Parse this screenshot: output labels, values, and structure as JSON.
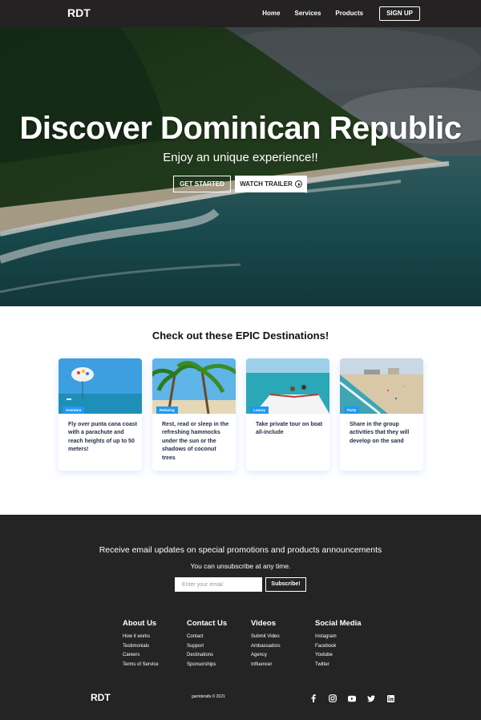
{
  "navbar": {
    "logo": "RDT",
    "links": [
      "Home",
      "Services",
      "Products"
    ],
    "signup": "SIGN UP"
  },
  "hero": {
    "title": "Discover Dominican Republic",
    "subtitle": "Enjoy an unique experience!!",
    "get_started": "GET STARTED",
    "watch_trailer": "WATCH TRAILER",
    "play_icon": "play-circle-icon"
  },
  "destinations": {
    "heading": "Check out these EPIC Destinations!",
    "cards": [
      {
        "badge": "Aventura",
        "text": "Fly over punta cana coast with a parachute and reach heights of up to 50 meters!"
      },
      {
        "badge": "Relaxing",
        "text": "Rest, read or sleep in the refreshing hammocks under the sun or the shadows of coconut trees"
      },
      {
        "badge": "Luxury",
        "text": "Take private tour on boat all-include"
      },
      {
        "badge": "Party",
        "text": "Share in the group activities that they will develop on the sand"
      }
    ]
  },
  "footer": {
    "subscription_heading": "Receive email updates on special promotions and products announcements",
    "subscription_text": "You can unsubscribe at any time.",
    "email_placeholder": "Enter your email",
    "subscribe_label": "Subscribe!",
    "columns": [
      {
        "title": "About Us",
        "links": [
          "How it works",
          "Testimonials",
          "Careers",
          "Terms of Service"
        ]
      },
      {
        "title": "Contact Us",
        "links": [
          "Contact",
          "Support",
          "Destinations",
          "Sponsorships"
        ]
      },
      {
        "title": "Videos",
        "links": [
          "Submit Video",
          "Ambassadors",
          "Agency",
          "Influencer"
        ]
      },
      {
        "title": "Social Media",
        "links": [
          "Instagram",
          "Facebook",
          "Youtube",
          "Twitter"
        ]
      }
    ],
    "logo": "RDT",
    "copyright": "garriderafa © 2021",
    "social_icons": [
      "facebook-icon",
      "instagram-icon",
      "youtube-icon",
      "twitter-icon",
      "linkedin-icon"
    ]
  },
  "colors": {
    "nav_bg": "#242222",
    "footer_bg": "#242424",
    "badge": "#1f98f4",
    "card_text": "#252e48"
  }
}
